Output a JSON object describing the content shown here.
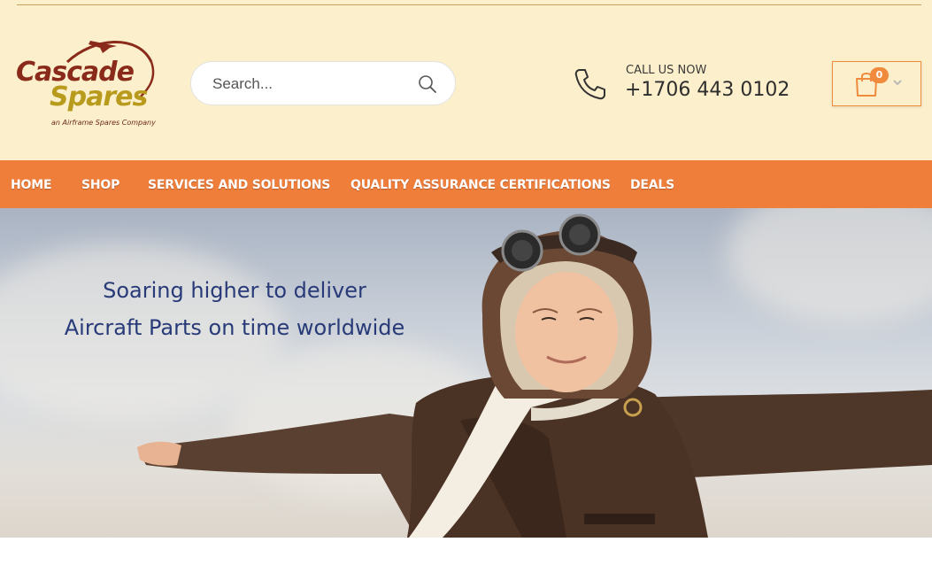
{
  "logo": {
    "line1": "Cascade",
    "line2": "Spares",
    "tagline": "an Airframe Spares Company"
  },
  "search": {
    "placeholder": "Search..."
  },
  "contact": {
    "label": "CALL US NOW",
    "phone": "+1706 443 0102"
  },
  "cart": {
    "count": "0"
  },
  "nav": {
    "items": [
      {
        "label": "HOME"
      },
      {
        "label": "SHOP"
      },
      {
        "label": "SERVICES AND SOLUTIONS"
      },
      {
        "label": "QUALITY ASSURANCE CERTIFICATIONS"
      },
      {
        "label": "DEALS"
      }
    ]
  },
  "hero": {
    "line1": "Soaring higher to deliver",
    "line2": "Aircraft Parts on time worldwide"
  },
  "colors": {
    "header_bg": "#fcefcb",
    "accent": "#ef7e3b",
    "headline": "#283a78"
  }
}
